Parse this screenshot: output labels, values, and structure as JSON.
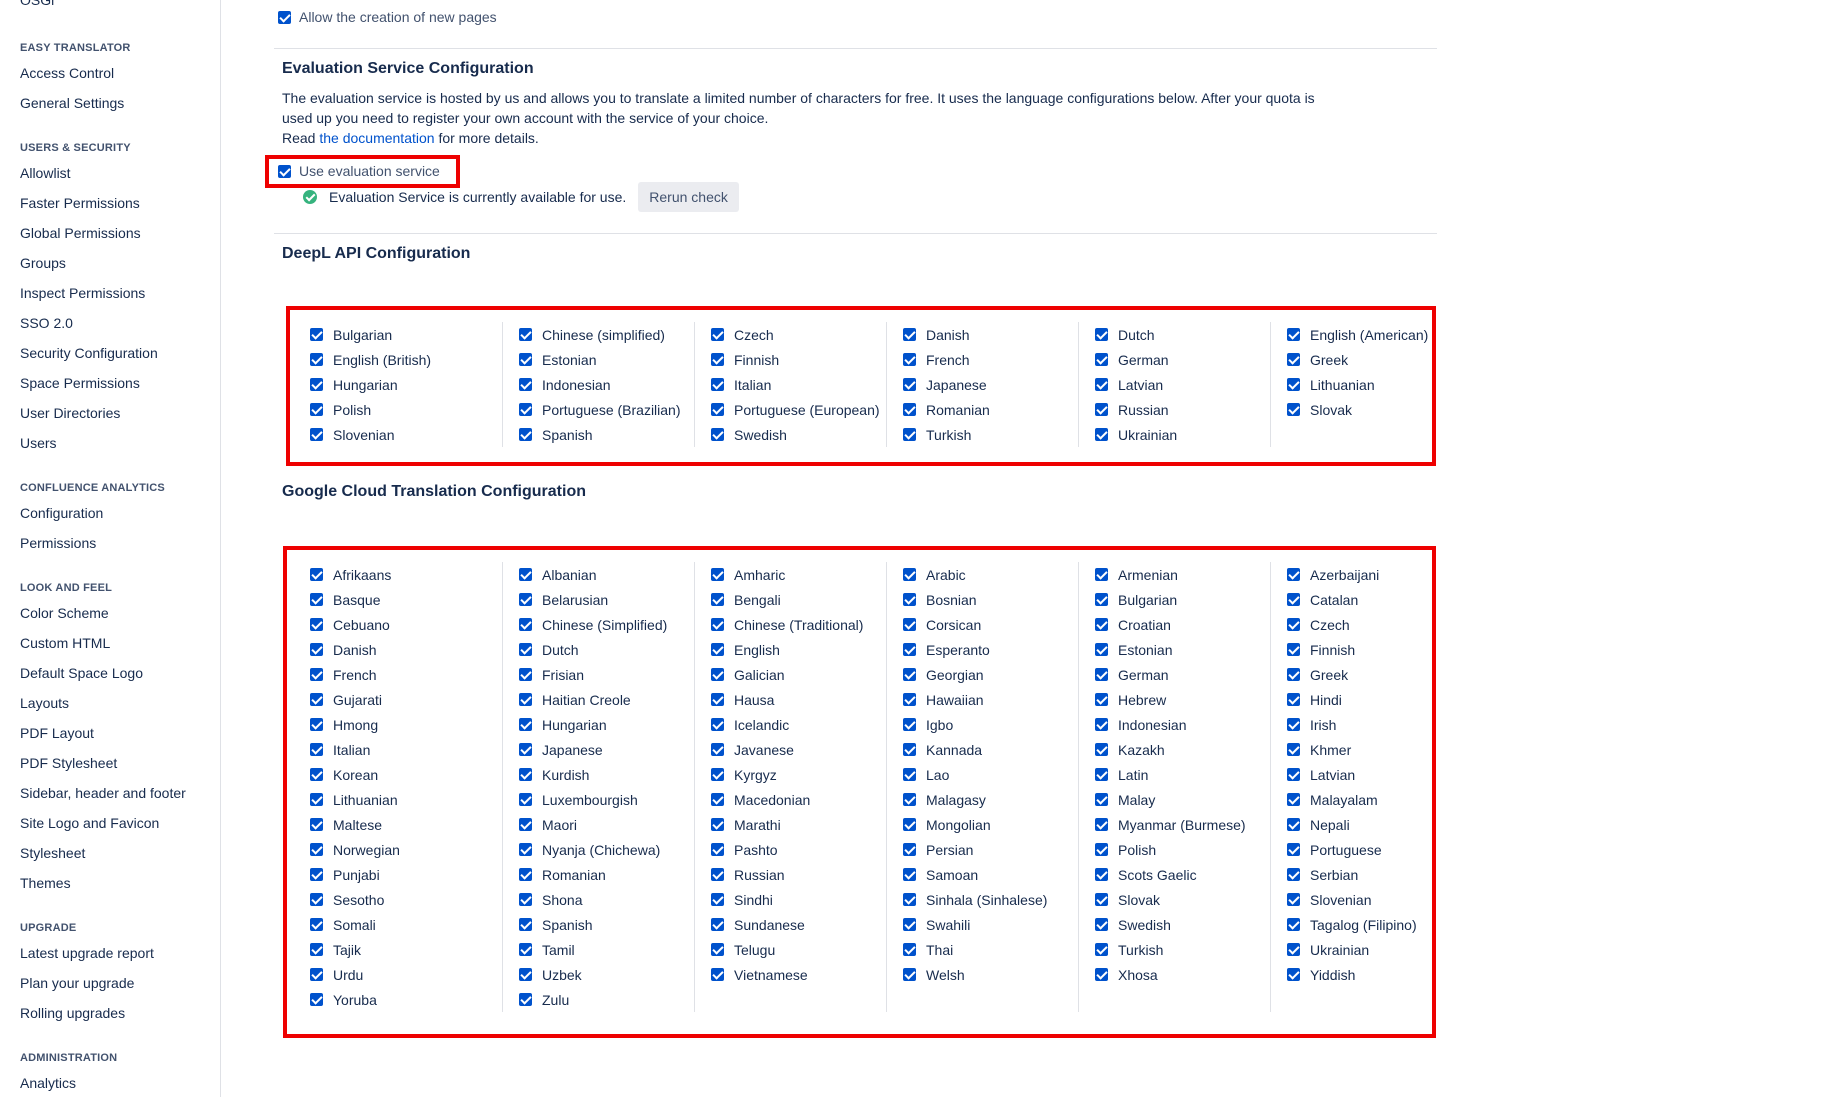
{
  "sidebar": {
    "top_item": "OSGi",
    "sections": [
      {
        "heading": "EASY TRANSLATOR",
        "items": [
          "Access Control",
          "General Settings"
        ]
      },
      {
        "heading": "USERS & SECURITY",
        "items": [
          "Allowlist",
          "Faster Permissions",
          "Global Permissions",
          "Groups",
          "Inspect Permissions",
          "SSO 2.0",
          "Security Configuration",
          "Space Permissions",
          "User Directories",
          "Users"
        ]
      },
      {
        "heading": "CONFLUENCE ANALYTICS",
        "items": [
          "Configuration",
          "Permissions"
        ]
      },
      {
        "heading": "LOOK AND FEEL",
        "items": [
          "Color Scheme",
          "Custom HTML",
          "Default Space Logo",
          "Layouts",
          "PDF Layout",
          "PDF Stylesheet",
          "Sidebar, header and footer",
          "Site Logo and Favicon",
          "Stylesheet",
          "Themes"
        ]
      },
      {
        "heading": "UPGRADE",
        "items": [
          "Latest upgrade report",
          "Plan your upgrade",
          "Rolling upgrades"
        ]
      },
      {
        "heading": "ADMINISTRATION",
        "items": [
          "Analytics"
        ]
      }
    ]
  },
  "main": {
    "allow_new_pages_label": "Allow the creation of new pages",
    "evaluation": {
      "title": "Evaluation Service Configuration",
      "desc_line1": "The evaluation service is hosted by us and allows you to translate a limited number of characters for free. It uses the language configurations below. After your quota is",
      "desc_line2": "used up you need to register your own account with the service of your choice.",
      "read_prefix": "Read ",
      "doc_link": "the documentation",
      "read_suffix": " for more details.",
      "checkbox_label": "Use evaluation service",
      "status_text": "Evaluation Service is currently available for use.",
      "rerun_button": "Rerun check"
    },
    "deepl": {
      "title": "DeepL API Configuration",
      "columns": [
        [
          "Bulgarian",
          "English (British)",
          "Hungarian",
          "Polish",
          "Slovenian"
        ],
        [
          "Chinese (simplified)",
          "Estonian",
          "Indonesian",
          "Portuguese (Brazilian)",
          "Spanish"
        ],
        [
          "Czech",
          "Finnish",
          "Italian",
          "Portuguese (European)",
          "Swedish"
        ],
        [
          "Danish",
          "French",
          "Japanese",
          "Romanian",
          "Turkish"
        ],
        [
          "Dutch",
          "German",
          "Latvian",
          "Russian",
          "Ukrainian"
        ],
        [
          "English (American)",
          "Greek",
          "Lithuanian",
          "Slovak"
        ]
      ]
    },
    "google": {
      "title": "Google Cloud Translation Configuration",
      "columns": [
        [
          "Afrikaans",
          "Basque",
          "Cebuano",
          "Danish",
          "French",
          "Gujarati",
          "Hmong",
          "Italian",
          "Korean",
          "Lithuanian",
          "Maltese",
          "Norwegian",
          "Punjabi",
          "Sesotho",
          "Somali",
          "Tajik",
          "Urdu",
          "Yoruba"
        ],
        [
          "Albanian",
          "Belarusian",
          "Chinese (Simplified)",
          "Dutch",
          "Frisian",
          "Haitian Creole",
          "Hungarian",
          "Japanese",
          "Kurdish",
          "Luxembourgish",
          "Maori",
          "Nyanja (Chichewa)",
          "Romanian",
          "Shona",
          "Spanish",
          "Tamil",
          "Uzbek",
          "Zulu"
        ],
        [
          "Amharic",
          "Bengali",
          "Chinese (Traditional)",
          "English",
          "Galician",
          "Hausa",
          "Icelandic",
          "Javanese",
          "Kyrgyz",
          "Macedonian",
          "Marathi",
          "Pashto",
          "Russian",
          "Sindhi",
          "Sundanese",
          "Telugu",
          "Vietnamese"
        ],
        [
          "Arabic",
          "Bosnian",
          "Corsican",
          "Esperanto",
          "Georgian",
          "Hawaiian",
          "Igbo",
          "Kannada",
          "Lao",
          "Malagasy",
          "Mongolian",
          "Persian",
          "Samoan",
          "Sinhala (Sinhalese)",
          "Swahili",
          "Thai",
          "Welsh"
        ],
        [
          "Armenian",
          "Bulgarian",
          "Croatian",
          "Estonian",
          "German",
          "Hebrew",
          "Indonesian",
          "Kazakh",
          "Latin",
          "Malay",
          "Myanmar (Burmese)",
          "Polish",
          "Scots Gaelic",
          "Slovak",
          "Swedish",
          "Turkish",
          "Xhosa"
        ],
        [
          "Azerbaijani",
          "Catalan",
          "Czech",
          "Finnish",
          "Greek",
          "Hindi",
          "Irish",
          "Khmer",
          "Latvian",
          "Malayalam",
          "Nepali",
          "Portuguese",
          "Serbian",
          "Slovenian",
          "Tagalog (Filipino)",
          "Ukrainian",
          "Yiddish"
        ]
      ]
    }
  },
  "colors": {
    "accent": "#0052cc",
    "highlight": "#ee0000",
    "success": "#36b37e"
  }
}
